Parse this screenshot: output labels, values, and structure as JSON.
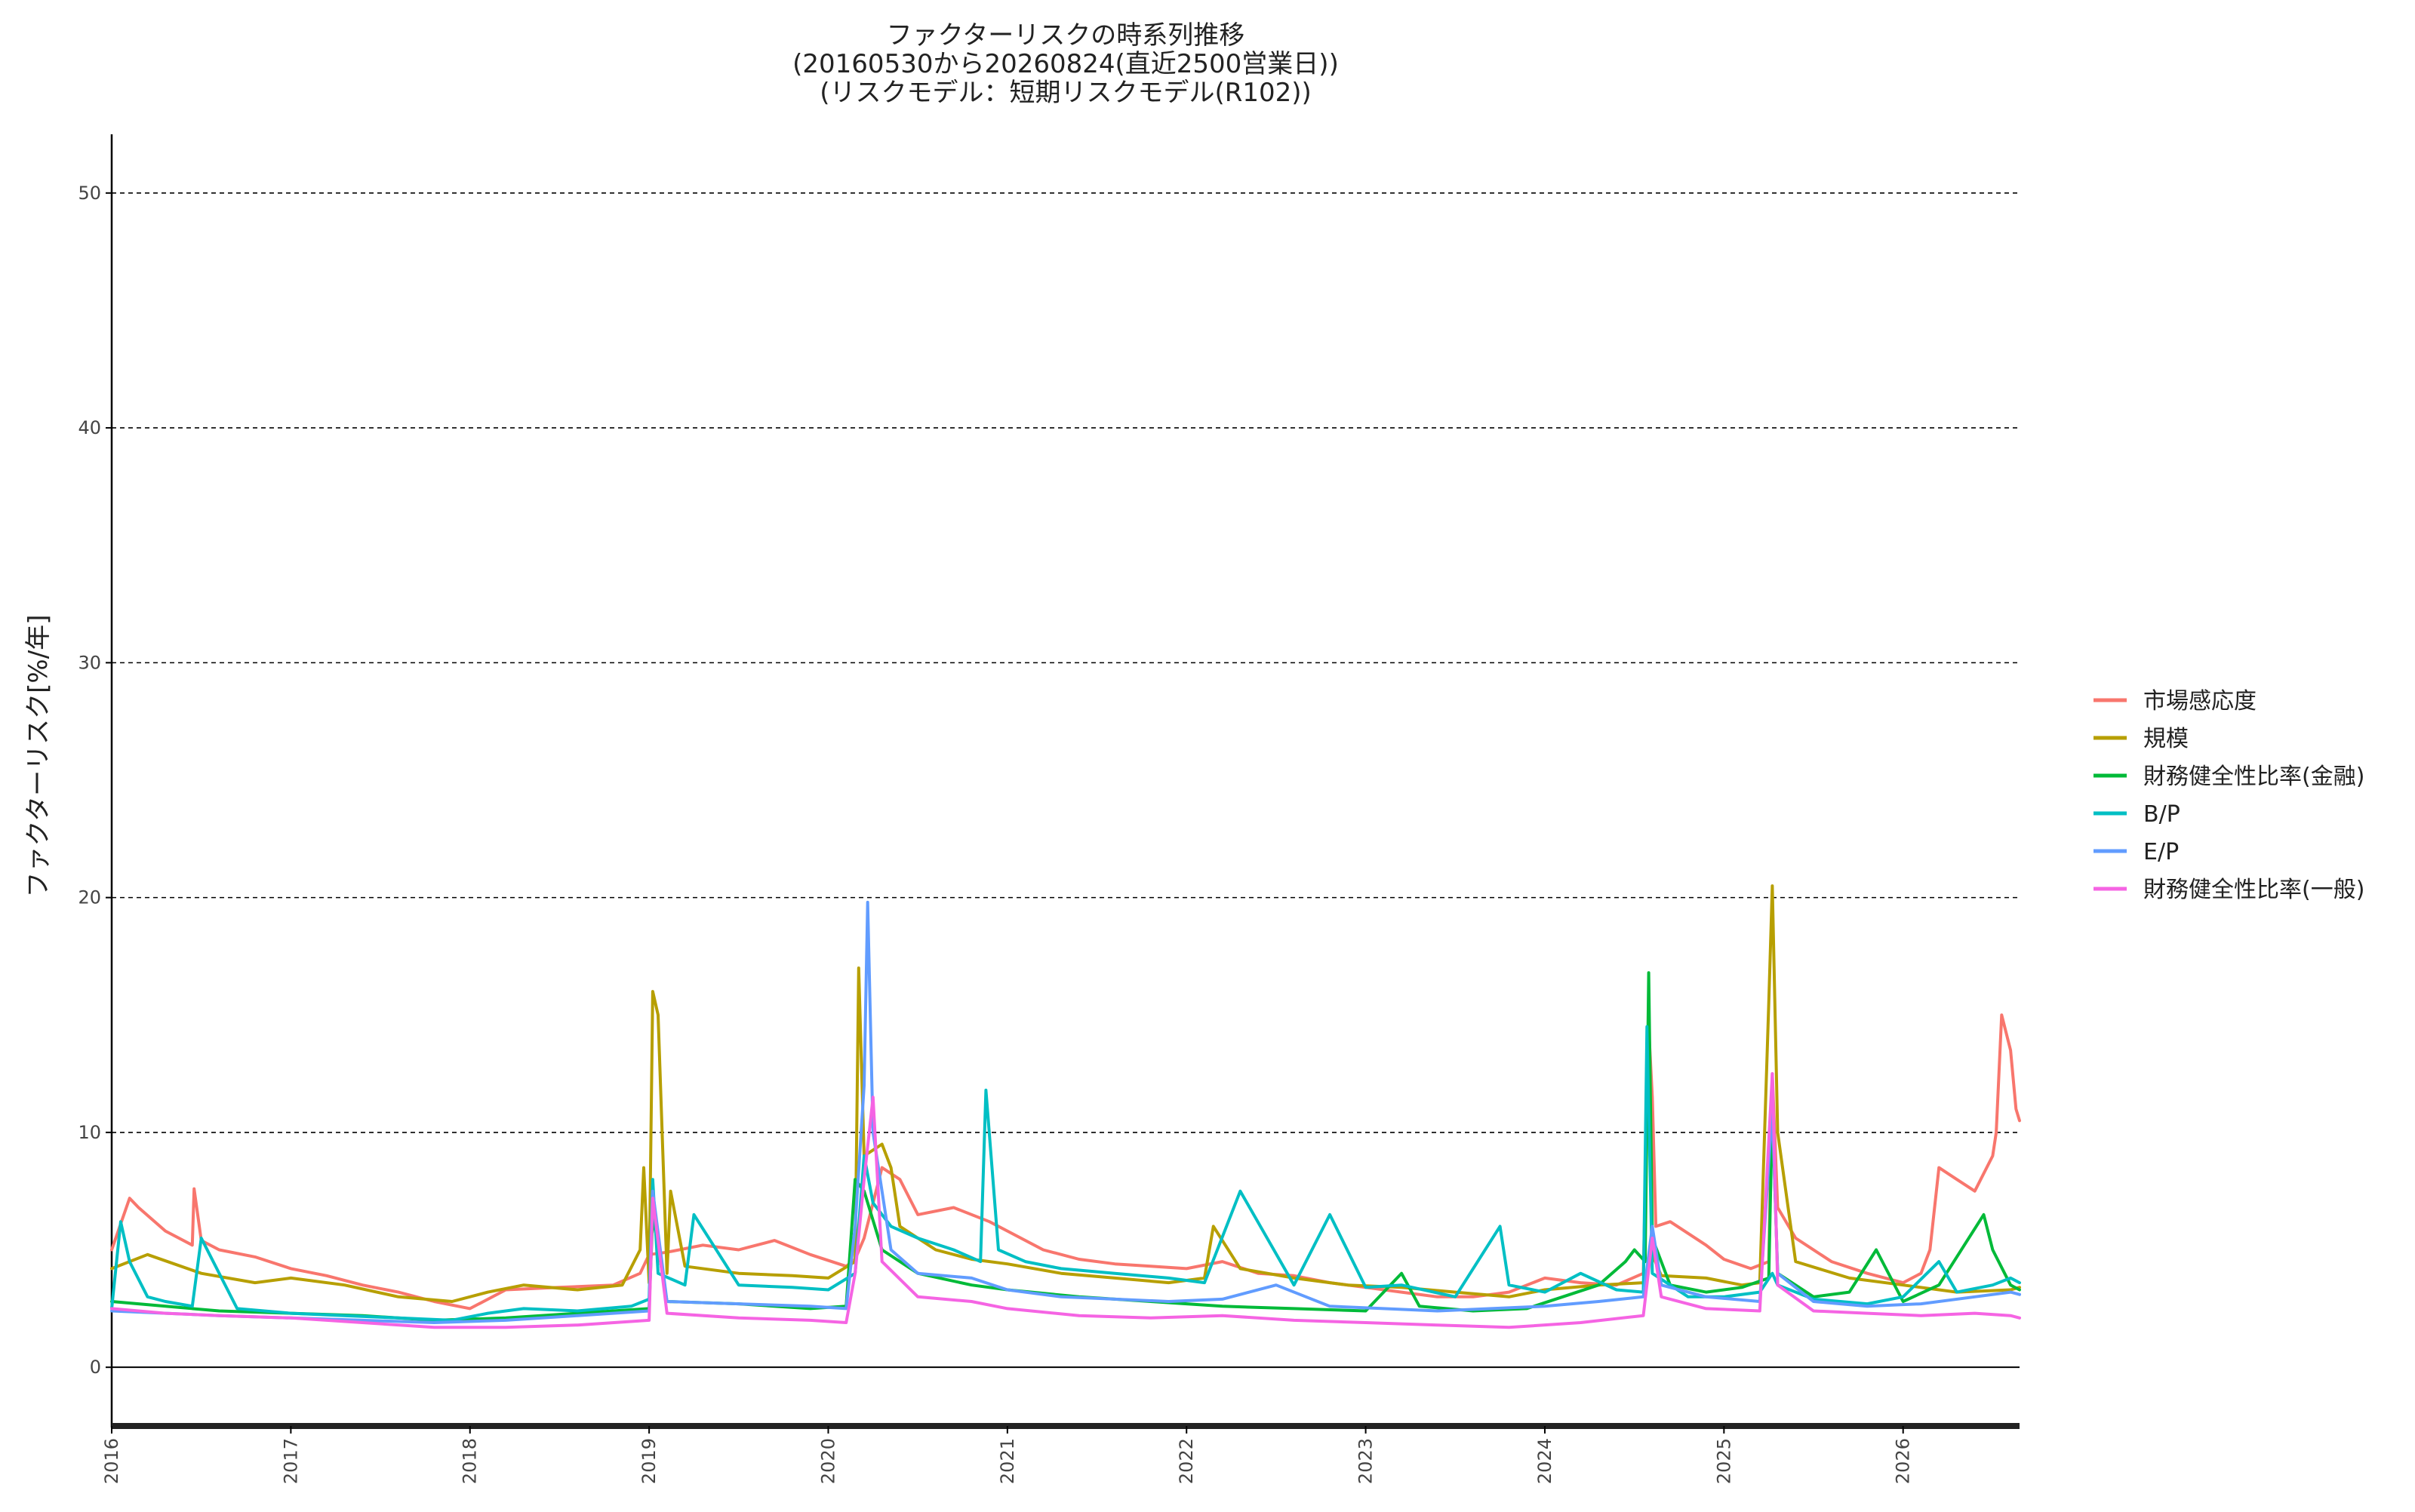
{
  "chart_data": {
    "type": "line",
    "title": [
      "ファクターリスクの時系列推移",
      "(20160530から20260824(直近2500営業日))",
      "(リスクモデル：短期リスクモデル(R102))"
    ],
    "xlabel": "",
    "ylabel": "ファクターリスク[%/年]",
    "ylim": [
      -2.5,
      52.5
    ],
    "xlim": [
      2016.0,
      2026.65
    ],
    "y_ticks": [
      0,
      10,
      20,
      30,
      40,
      50
    ],
    "x_ticks": [
      2016,
      2017,
      2018,
      2019,
      2020,
      2021,
      2022,
      2023,
      2024,
      2025,
      2026
    ],
    "x_tick_labels": [
      "2016",
      "2017",
      "2018",
      "2019",
      "2020",
      "2021",
      "2022",
      "2023",
      "2024",
      "2025",
      "2026"
    ],
    "grid": "horizontal dashed",
    "legend_position": "right",
    "series": [
      {
        "name": "市場感応度",
        "color": "#F8766D",
        "x": [
          2016.0,
          2016.1,
          2016.15,
          2016.3,
          2016.45,
          2016.46,
          2016.5,
          2016.6,
          2016.8,
          2017.0,
          2017.2,
          2017.4,
          2017.6,
          2017.8,
          2018.0,
          2018.2,
          2018.5,
          2018.8,
          2018.95,
          2019.0,
          2019.1,
          2019.3,
          2019.5,
          2019.7,
          2019.9,
          2020.1,
          2020.15,
          2020.2,
          2020.3,
          2020.4,
          2020.5,
          2020.7,
          2020.9,
          2021.0,
          2021.2,
          2021.4,
          2021.6,
          2021.8,
          2022.0,
          2022.2,
          2022.4,
          2022.6,
          2022.8,
          2023.0,
          2023.2,
          2023.4,
          2023.6,
          2023.8,
          2024.0,
          2024.2,
          2024.4,
          2024.55,
          2024.58,
          2024.6,
          2024.62,
          2024.7,
          2024.9,
          2025.0,
          2025.15,
          2025.25,
          2025.27,
          2025.3,
          2025.4,
          2025.6,
          2025.8,
          2026.0,
          2026.1,
          2026.15,
          2026.2,
          2026.3,
          2026.4,
          2026.5,
          2026.52,
          2026.55,
          2026.6,
          2026.63,
          2026.65
        ],
        "y": [
          5.0,
          7.2,
          6.8,
          5.8,
          5.2,
          7.6,
          5.4,
          5.0,
          4.7,
          4.2,
          3.9,
          3.5,
          3.2,
          2.8,
          2.5,
          3.3,
          3.4,
          3.5,
          4.0,
          4.8,
          4.9,
          5.2,
          5.0,
          5.4,
          4.8,
          4.3,
          4.6,
          5.5,
          8.5,
          8.0,
          6.5,
          6.8,
          6.2,
          5.8,
          5.0,
          4.6,
          4.4,
          4.3,
          4.2,
          4.5,
          4.0,
          3.9,
          3.6,
          3.4,
          3.2,
          3.0,
          3.0,
          3.2,
          3.8,
          3.6,
          3.5,
          4.0,
          14.5,
          11.5,
          6.0,
          6.2,
          5.2,
          4.6,
          4.2,
          4.5,
          12.5,
          6.8,
          5.5,
          4.5,
          4.0,
          3.6,
          4.0,
          5.0,
          8.5,
          8.0,
          7.5,
          9.0,
          10.0,
          15.0,
          13.5,
          11.0,
          10.5
        ]
      },
      {
        "name": "規模",
        "color": "#B79F00",
        "x": [
          2016.0,
          2016.2,
          2016.5,
          2016.8,
          2017.0,
          2017.3,
          2017.6,
          2017.9,
          2018.1,
          2018.3,
          2018.6,
          2018.85,
          2018.95,
          2018.97,
          2019.0,
          2019.02,
          2019.05,
          2019.1,
          2019.12,
          2019.2,
          2019.5,
          2019.8,
          2020.0,
          2020.15,
          2020.17,
          2020.2,
          2020.3,
          2020.35,
          2020.4,
          2020.6,
          2020.8,
          2021.0,
          2021.3,
          2021.6,
          2021.9,
          2022.1,
          2022.15,
          2022.3,
          2022.6,
          2022.9,
          2023.2,
          2023.5,
          2023.8,
          2024.0,
          2024.3,
          2024.55,
          2024.6,
          2024.65,
          2024.9,
          2025.1,
          2025.2,
          2025.25,
          2025.27,
          2025.3,
          2025.4,
          2025.7,
          2026.0,
          2026.3,
          2026.6,
          2026.65
        ],
        "y": [
          4.2,
          4.8,
          4.0,
          3.6,
          3.8,
          3.5,
          3.0,
          2.8,
          3.2,
          3.5,
          3.3,
          3.5,
          5.0,
          8.5,
          3.6,
          16.0,
          15.0,
          4.0,
          7.5,
          4.3,
          4.0,
          3.9,
          3.8,
          4.5,
          17.0,
          9.0,
          9.5,
          8.5,
          6.0,
          5.0,
          4.6,
          4.4,
          4.0,
          3.8,
          3.6,
          3.8,
          6.0,
          4.2,
          3.8,
          3.5,
          3.4,
          3.2,
          3.0,
          3.3,
          3.5,
          3.6,
          4.8,
          3.9,
          3.8,
          3.5,
          3.6,
          15.5,
          20.5,
          10.0,
          4.5,
          3.8,
          3.5,
          3.2,
          3.3,
          3.4
        ]
      },
      {
        "name": "財務健全性比率(金融)",
        "color": "#00BA38",
        "x": [
          2016.0,
          2016.3,
          2016.6,
          2017.0,
          2017.4,
          2017.8,
          2018.2,
          2018.6,
          2019.0,
          2019.02,
          2019.1,
          2019.5,
          2019.9,
          2020.1,
          2020.15,
          2020.2,
          2020.3,
          2020.5,
          2020.8,
          2021.0,
          2021.4,
          2021.8,
          2022.2,
          2022.6,
          2023.0,
          2023.2,
          2023.3,
          2023.6,
          2023.9,
          2024.1,
          2024.3,
          2024.45,
          2024.5,
          2024.56,
          2024.58,
          2024.6,
          2024.7,
          2024.9,
          2025.1,
          2025.25,
          2025.27,
          2025.3,
          2025.5,
          2025.7,
          2025.85,
          2026.0,
          2026.2,
          2026.45,
          2026.5,
          2026.6,
          2026.65
        ],
        "y": [
          2.8,
          2.6,
          2.4,
          2.3,
          2.2,
          2.0,
          2.1,
          2.3,
          2.5,
          6.5,
          2.8,
          2.7,
          2.5,
          2.6,
          8.0,
          7.5,
          5.0,
          4.0,
          3.5,
          3.3,
          3.0,
          2.8,
          2.6,
          2.5,
          2.4,
          4.0,
          2.6,
          2.4,
          2.5,
          3.0,
          3.5,
          4.5,
          5.0,
          4.5,
          16.8,
          5.5,
          3.5,
          3.2,
          3.4,
          3.8,
          11.0,
          4.0,
          3.0,
          3.2,
          5.0,
          2.8,
          3.5,
          6.5,
          5.0,
          3.5,
          3.3
        ]
      },
      {
        "name": "B/P",
        "color": "#00BFC4",
        "x": [
          2016.0,
          2016.05,
          2016.1,
          2016.2,
          2016.3,
          2016.45,
          2016.5,
          2016.7,
          2017.0,
          2017.3,
          2017.6,
          2017.9,
          2018.1,
          2018.3,
          2018.6,
          2018.9,
          2019.0,
          2019.02,
          2019.05,
          2019.2,
          2019.25,
          2019.5,
          2019.8,
          2020.0,
          2020.15,
          2020.2,
          2020.25,
          2020.35,
          2020.5,
          2020.7,
          2020.85,
          2020.88,
          2020.95,
          2021.1,
          2021.3,
          2021.6,
          2021.9,
          2022.1,
          2022.3,
          2022.6,
          2022.8,
          2023.0,
          2023.2,
          2023.5,
          2023.75,
          2023.8,
          2024.0,
          2024.2,
          2024.4,
          2024.55,
          2024.57,
          2024.6,
          2024.8,
          2025.0,
          2025.2,
          2025.27,
          2025.3,
          2025.5,
          2025.8,
          2026.0,
          2026.2,
          2026.3,
          2026.5,
          2026.6,
          2026.65
        ],
        "y": [
          2.5,
          6.2,
          4.5,
          3.0,
          2.8,
          2.6,
          5.5,
          2.5,
          2.3,
          2.2,
          2.1,
          2.0,
          2.3,
          2.5,
          2.4,
          2.6,
          2.9,
          8.0,
          4.0,
          3.5,
          6.5,
          3.5,
          3.4,
          3.3,
          4.0,
          9.0,
          7.0,
          6.0,
          5.5,
          5.0,
          4.5,
          11.8,
          5.0,
          4.5,
          4.2,
          4.0,
          3.8,
          3.6,
          7.5,
          3.5,
          6.5,
          3.4,
          3.5,
          3.0,
          6.0,
          3.5,
          3.2,
          4.0,
          3.3,
          3.2,
          14.5,
          4.0,
          3.0,
          3.0,
          3.2,
          4.0,
          3.5,
          2.9,
          2.7,
          3.0,
          4.5,
          3.2,
          3.5,
          3.8,
          3.6
        ]
      },
      {
        "name": "E/P",
        "color": "#619CFF",
        "x": [
          2016.0,
          2016.3,
          2016.6,
          2017.0,
          2017.4,
          2017.8,
          2018.2,
          2018.6,
          2019.0,
          2019.02,
          2019.1,
          2019.5,
          2019.9,
          2020.1,
          2020.15,
          2020.2,
          2020.22,
          2020.25,
          2020.35,
          2020.5,
          2020.8,
          2021.0,
          2021.3,
          2021.6,
          2021.9,
          2022.2,
          2022.5,
          2022.8,
          2023.1,
          2023.4,
          2023.7,
          2024.0,
          2024.3,
          2024.55,
          2024.6,
          2024.65,
          2024.9,
          2025.2,
          2025.27,
          2025.3,
          2025.5,
          2025.8,
          2026.1,
          2026.4,
          2026.6,
          2026.65
        ],
        "y": [
          2.4,
          2.3,
          2.2,
          2.1,
          2.0,
          1.9,
          2.0,
          2.2,
          2.4,
          7.5,
          2.8,
          2.7,
          2.6,
          2.5,
          6.0,
          12.0,
          19.8,
          10.0,
          5.0,
          4.0,
          3.8,
          3.3,
          3.0,
          2.9,
          2.8,
          2.9,
          3.5,
          2.6,
          2.5,
          2.4,
          2.5,
          2.6,
          2.8,
          3.0,
          6.0,
          3.5,
          3.0,
          2.8,
          11.0,
          4.0,
          2.8,
          2.6,
          2.7,
          3.0,
          3.2,
          3.1
        ]
      },
      {
        "name": "財務健全性比率(一般)",
        "color": "#F564E3",
        "x": [
          2016.0,
          2016.3,
          2016.6,
          2017.0,
          2017.4,
          2017.8,
          2018.2,
          2018.6,
          2019.0,
          2019.02,
          2019.1,
          2019.5,
          2019.9,
          2020.1,
          2020.15,
          2020.2,
          2020.25,
          2020.3,
          2020.5,
          2020.8,
          2021.0,
          2021.4,
          2021.8,
          2022.2,
          2022.6,
          2023.0,
          2023.4,
          2023.8,
          2024.2,
          2024.55,
          2024.6,
          2024.65,
          2024.9,
          2025.2,
          2025.27,
          2025.3,
          2025.5,
          2025.8,
          2026.1,
          2026.4,
          2026.6,
          2026.65
        ],
        "y": [
          2.5,
          2.3,
          2.2,
          2.1,
          1.9,
          1.7,
          1.7,
          1.8,
          2.0,
          7.2,
          2.3,
          2.1,
          2.0,
          1.9,
          4.0,
          8.0,
          11.5,
          4.5,
          3.0,
          2.8,
          2.5,
          2.2,
          2.1,
          2.2,
          2.0,
          1.9,
          1.8,
          1.7,
          1.9,
          2.2,
          5.5,
          3.0,
          2.5,
          2.4,
          12.5,
          3.5,
          2.4,
          2.3,
          2.2,
          2.3,
          2.2,
          2.1
        ]
      }
    ]
  }
}
